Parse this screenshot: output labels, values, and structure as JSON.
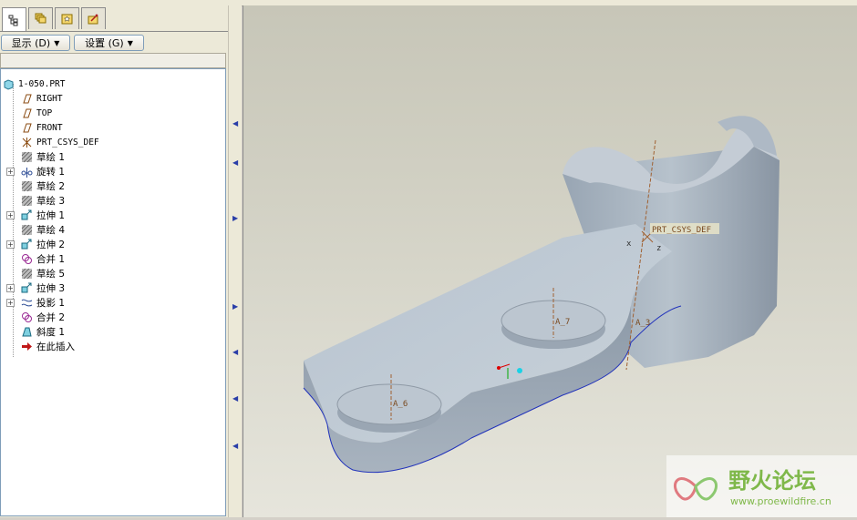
{
  "tabs": [
    {
      "name": "model-tree-tab",
      "icon": "model-tree-icon"
    },
    {
      "name": "layers-tab",
      "icon": "layers-icon"
    },
    {
      "name": "favorites-tab",
      "icon": "star-folder-icon"
    },
    {
      "name": "tools-tab",
      "icon": "tools-icon"
    }
  ],
  "menu": {
    "show_label": "显示 (D)",
    "settings_label": "设置 (G)"
  },
  "tree": [
    {
      "label": "1-050.PRT",
      "icon": "part-icon",
      "expandable": false,
      "mono": true
    },
    {
      "label": "RIGHT",
      "icon": "datum-plane-icon",
      "expandable": false,
      "mono": true
    },
    {
      "label": "TOP",
      "icon": "datum-plane-icon",
      "expandable": false,
      "mono": true
    },
    {
      "label": "FRONT",
      "icon": "datum-plane-icon",
      "expandable": false,
      "mono": true
    },
    {
      "label": "PRT_CSYS_DEF",
      "icon": "csys-icon",
      "expandable": false,
      "mono": true
    },
    {
      "label": "草绘 1",
      "icon": "sketch-icon",
      "expandable": false
    },
    {
      "label": "旋转 1",
      "icon": "revolve-icon",
      "expandable": true
    },
    {
      "label": "草绘 2",
      "icon": "sketch-icon",
      "expandable": false
    },
    {
      "label": "草绘 3",
      "icon": "sketch-icon",
      "expandable": false
    },
    {
      "label": "拉伸 1",
      "icon": "extrude-icon",
      "expandable": true
    },
    {
      "label": "草绘 4",
      "icon": "sketch-icon",
      "expandable": false
    },
    {
      "label": "拉伸 2",
      "icon": "extrude-icon",
      "expandable": true
    },
    {
      "label": "合并 1",
      "icon": "merge-icon",
      "expandable": false
    },
    {
      "label": "草绘 5",
      "icon": "sketch-icon",
      "expandable": false
    },
    {
      "label": "拉伸 3",
      "icon": "extrude-icon",
      "expandable": true
    },
    {
      "label": "投影 1",
      "icon": "projection-icon",
      "expandable": true
    },
    {
      "label": "合并 2",
      "icon": "merge-icon",
      "expandable": false
    },
    {
      "label": "斜度 1",
      "icon": "draft-icon",
      "expandable": false
    },
    {
      "label": "在此插入",
      "icon": "insert-arrow-icon",
      "expandable": false
    }
  ],
  "viewport": {
    "csys_label": "PRT_CSYS_DEF",
    "axis_a3": "A_3",
    "axis_a7": "A_7",
    "axis_a6": "A_6",
    "csys_x": "x",
    "csys_z": "z"
  },
  "watermark": {
    "title": "野火论坛",
    "url": "www.proewildfire.cn"
  }
}
